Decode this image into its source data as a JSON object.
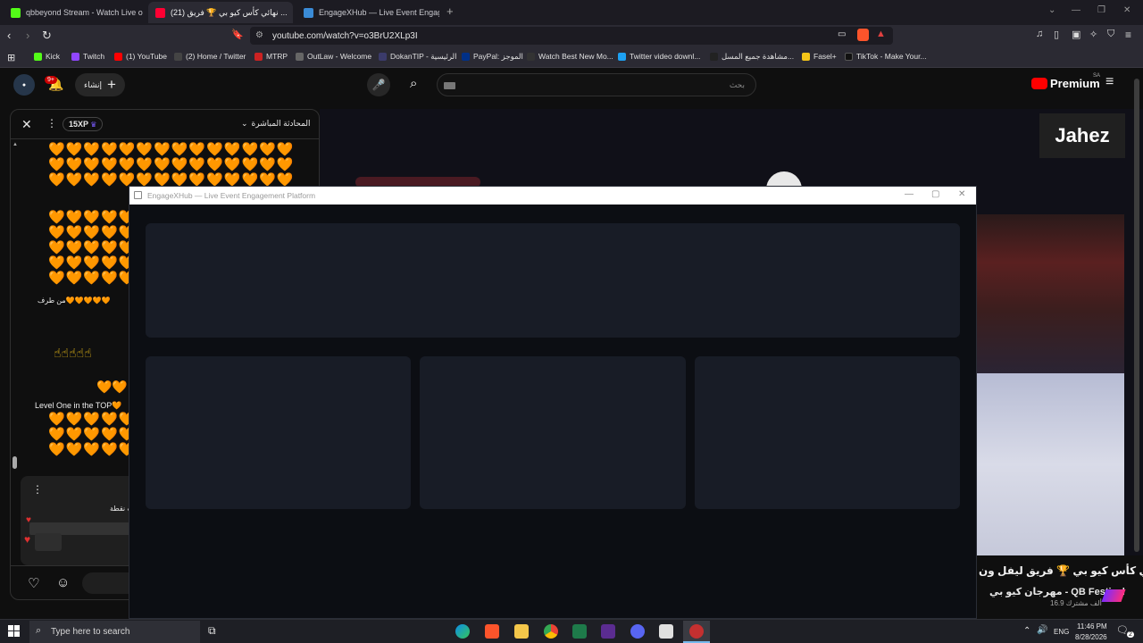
{
  "tabs": [
    {
      "title": "qbbeyond Stream - Watch Live o",
      "color": "#53fc18"
    },
    {
      "title": "(21) نهائي كأس كيو بي 🏆 فريق ...",
      "color": "#ff0033"
    },
    {
      "title": "EngageXHub — Live Event Engagem",
      "color": "#3a8bd6"
    }
  ],
  "new_tab": "+",
  "address": {
    "url": "youtube.com/watch?v=o3BrU2XLp3I"
  },
  "bookmarks": [
    {
      "label": "Kick",
      "color": "#53fc18"
    },
    {
      "label": "Twitch",
      "color": "#9146ff"
    },
    {
      "label": "(1) YouTube",
      "color": "#ff0000"
    },
    {
      "label": "(2) Home / Twitter",
      "color": "#444444"
    },
    {
      "label": "MTRP",
      "color": "#cc2222"
    },
    {
      "label": "OutLaw - Welcome",
      "color": "#666666"
    },
    {
      "label": "DokanTIP - الرئيسية",
      "color": "#3b3b6b"
    },
    {
      "label": "PayPal: الموجز",
      "color": "#003087"
    },
    {
      "label": "Watch Best New Mo...",
      "color": "#333333"
    },
    {
      "label": "Twitter video downl...",
      "color": "#1da1f2"
    },
    {
      "label": "مشاهدة جميع المسل...",
      "color": "#222222"
    },
    {
      "label": "Fasel+",
      "color": "#f5c518"
    },
    {
      "label": "TikTok - Make Your...",
      "color": "#111111"
    }
  ],
  "youtube": {
    "notif_count": "9+",
    "create_label": "إنشاء",
    "search_placeholder": "بحث",
    "premium_label": "Premium",
    "premium_region": "SA"
  },
  "chat": {
    "xp_badge": "15XP",
    "header_title": "المحادثة المباشرة",
    "heart_rows_a": [
      "🧡🧡🧡🧡🧡🧡🧡🧡🧡🧡🧡🧡🧡🧡",
      "🧡🧡🧡🧡🧡🧡🧡🧡🧡🧡🧡🧡🧡🧡",
      "🧡🧡🧡🧡🧡🧡🧡🧡🧡🧡🧡🧡🧡🧡"
    ],
    "heart_rows_b": [
      "🧡🧡🧡🧡🧡",
      "🧡🧡🧡🧡🧡",
      "🧡🧡🧡🧡🧡",
      "🧡🧡🧡🧡🧡",
      "🧡🧡🧡🧡🧡"
    ],
    "msg_from": "من طرف🧡🧡🧡🧡🧡",
    "fingers": "☝☝☝☝☝",
    "small_hearts": "🧡🧡",
    "level_msg": "Level One in the TOP🧡",
    "heart_rows_c": [
      "🧡🧡🧡🧡🧡",
      "🧡🧡🧡🧡🧡",
      "🧡🧡🧡🧡🧡"
    ],
    "card_text": "كسب نقطة"
  },
  "overlay": {
    "title": "EngageXHub — Live Event Engagement Platform"
  },
  "video": {
    "sponsor": "Jahez",
    "title": "نهائي كأس كيو بي 🏆 فريق ليفل ون",
    "channel": "مهرجان كيو بي - QB Festival",
    "subscribers": "16.9 ألف مشترك"
  },
  "taskbar": {
    "search_placeholder": "Type here to search",
    "lang": "ENG",
    "time": "11:46 PM",
    "date": "8/28/2026",
    "notif": "2"
  }
}
